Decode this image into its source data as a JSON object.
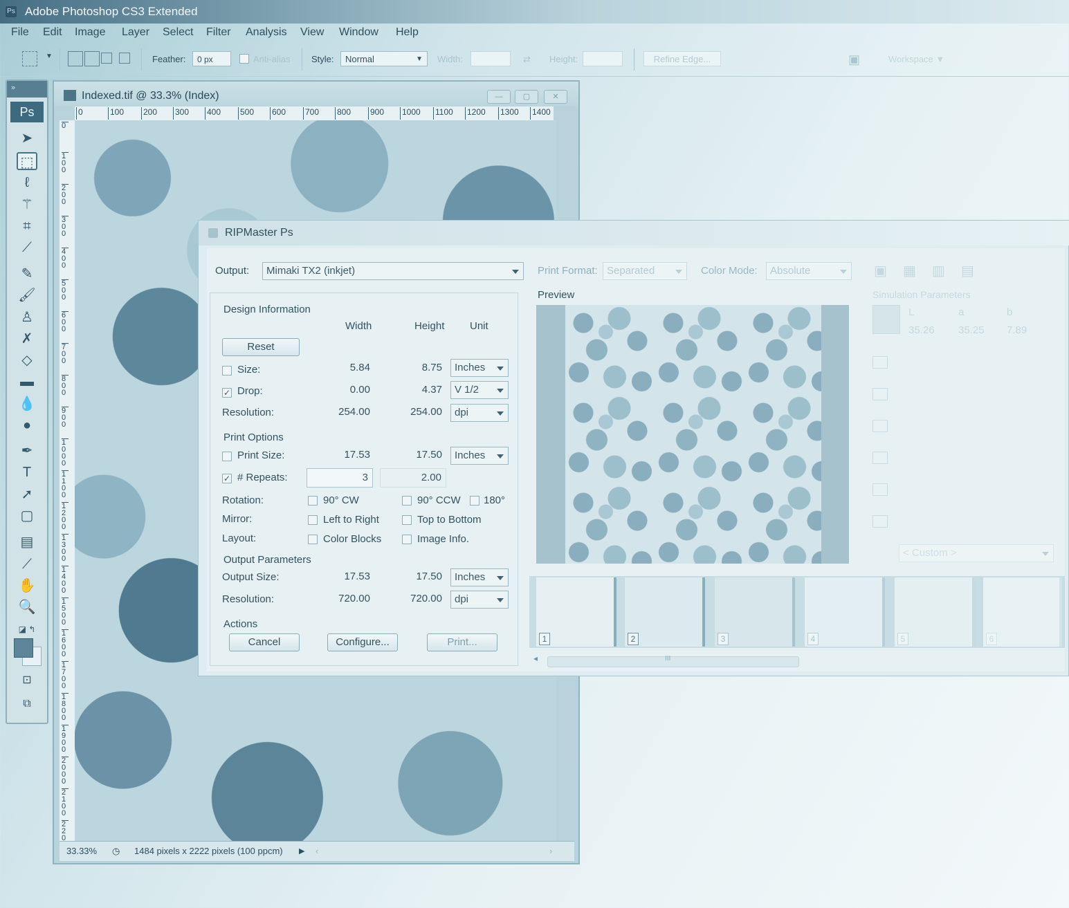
{
  "app": {
    "title": "Adobe Photoshop CS3 Extended",
    "icon_text": "Ps"
  },
  "menu": [
    "File",
    "Edit",
    "Image",
    "Layer",
    "Select",
    "Filter",
    "Analysis",
    "View",
    "Window",
    "Help"
  ],
  "options": {
    "feather_label": "Feather:",
    "feather_value": "0 px",
    "antialias_label": "Anti-alias",
    "style_label": "Style:",
    "style_value": "Normal",
    "width_label": "Width:",
    "height_label": "Height:",
    "refine_edge": "Refine Edge...",
    "workspace": "Workspace ▼"
  },
  "toolbox": {
    "logo": "Ps"
  },
  "document": {
    "title": "Indexed.tif @ 33.3% (Index)",
    "ruler_h": [
      "0",
      "100",
      "200",
      "300",
      "400",
      "500",
      "600",
      "700",
      "800",
      "900",
      "1000",
      "1100",
      "1200",
      "1300",
      "1400"
    ],
    "ruler_v": [
      "0",
      "100",
      "200",
      "300",
      "400",
      "500",
      "600",
      "700",
      "800",
      "900",
      "1000",
      "1100",
      "1200",
      "1300",
      "1400",
      "1500",
      "1600",
      "1700",
      "1800",
      "1900",
      "2000",
      "2100",
      "2200"
    ],
    "zoom": "33.33%",
    "status": "1484 pixels x 2222 pixels (100 ppcm)"
  },
  "dialog": {
    "title": "RIPMaster Ps",
    "output_label": "Output:",
    "output_value": "Mimaki TX2 (inkjet)",
    "print_format_label": "Print Format:",
    "print_format_value": "Separated",
    "color_mode_label": "Color Mode:",
    "color_mode_value": "Absolute",
    "preview_label": "Preview",
    "design": {
      "heading": "Design Information",
      "col_width": "Width",
      "col_height": "Height",
      "col_unit": "Unit",
      "reset": "Reset",
      "size_label": "Size:",
      "size_w": "5.84",
      "size_h": "8.75",
      "size_unit": "Inches",
      "drop_label": "Drop:",
      "drop_w": "0.00",
      "drop_h": "4.37",
      "drop_unit": "V 1/2",
      "res_label": "Resolution:",
      "res_w": "254.00",
      "res_h": "254.00",
      "res_unit": "dpi"
    },
    "print_options": {
      "heading": "Print Options",
      "print_size_label": "Print Size:",
      "print_size_w": "17.53",
      "print_size_h": "17.50",
      "print_size_unit": "Inches",
      "repeats_label": "# Repeats:",
      "repeats_w": "3",
      "repeats_h": "2.00",
      "rotation_label": "Rotation:",
      "rot_90cw": "90° CW",
      "rot_90ccw": "90° CCW",
      "rot_180": "180°",
      "mirror_label": "Mirror:",
      "mirror_lr": "Left to Right",
      "mirror_tb": "Top to Bottom",
      "layout_label": "Layout:",
      "layout_cb": "Color Blocks",
      "layout_ii": "Image Info."
    },
    "output_params": {
      "heading": "Output Parameters",
      "size_label": "Output Size:",
      "size_w": "17.53",
      "size_h": "17.50",
      "size_unit": "Inches",
      "res_label": "Resolution:",
      "res_w": "720.00",
      "res_h": "720.00",
      "res_unit": "dpi"
    },
    "actions": {
      "heading": "Actions",
      "cancel": "Cancel",
      "configure": "Configure...",
      "print": "Print..."
    },
    "thumbs": [
      "1",
      "2",
      "3",
      "4",
      "5",
      "6"
    ],
    "scroll_grip": "III",
    "simulation": {
      "heading": "Simulation Parameters",
      "l_label": "L",
      "a_label": "a",
      "b_label": "b",
      "l_value": "35.26",
      "a_value": "35.25",
      "b_value": "7.89",
      "custom": "< Custom >"
    }
  }
}
